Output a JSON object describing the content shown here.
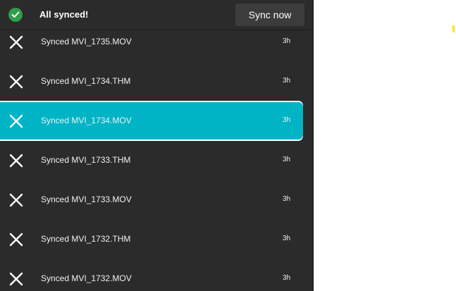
{
  "header": {
    "status_text": "All synced!",
    "sync_button_label": "Sync now",
    "status_icon": "check-icon",
    "status_color": "#2f9e4a"
  },
  "list": {
    "items": [
      {
        "name": "Synced MVI_1735.MOV",
        "age": "3h",
        "icon": "close-icon",
        "selected": false
      },
      {
        "name": "Synced MVI_1734.THM",
        "age": "3h",
        "icon": "close-icon",
        "selected": false
      },
      {
        "name": "Synced MVI_1734.MOV",
        "age": "3h",
        "icon": "close-icon",
        "selected": true
      },
      {
        "name": "Synced MVI_1733.THM",
        "age": "3h",
        "icon": "close-icon",
        "selected": false
      },
      {
        "name": "Synced MVI_1733.MOV",
        "age": "3h",
        "icon": "close-icon",
        "selected": false
      },
      {
        "name": "Synced MVI_1732.THM",
        "age": "3h",
        "icon": "close-icon",
        "selected": false
      },
      {
        "name": "Synced MVI_1732.MOV",
        "age": "3h",
        "icon": "close-icon",
        "selected": false
      }
    ]
  },
  "colors": {
    "panel_bg": "#2b2b2b",
    "accent_selected": "#00b4c6",
    "text": "#f0f0f0"
  }
}
